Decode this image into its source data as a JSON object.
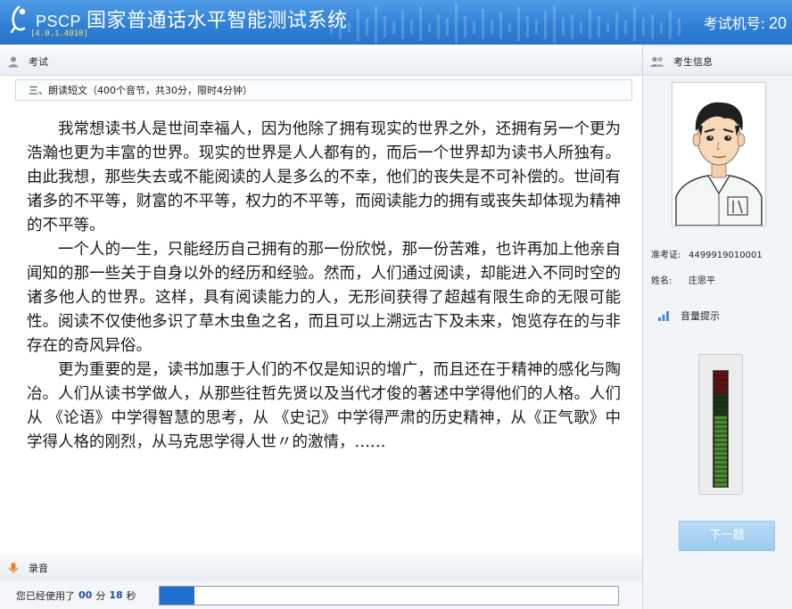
{
  "header": {
    "brand": "PSCP",
    "title": "国家普通话水平智能测试系统",
    "version": "[4.0.1.4010]",
    "machine_label": "考试机号:",
    "machine_number": "20"
  },
  "exam": {
    "section_label": "考试",
    "question_title": "三、朗读短文（400个音节，共30分，限时4分钟）",
    "paragraphs": [
      "我常想读书人是世间幸福人，因为他除了拥有现实的世界之外，还拥有另一个更为浩瀚也更为丰富的世界。现实的世界是人人都有的，而后一个世界却为读书人所独有。由此我想，那些失去或不能阅读的人是多么的不幸，他们的丧失是不可补偿的。世间有诸多的不平等，财富的不平等，权力的不平等，而阅读能力的拥有或丧失却体现为精神的不平等。",
      "一个人的一生，只能经历自己拥有的那一份欣悦，那一份苦难，也许再加上他亲自闻知的那一些关于自身以外的经历和经验。然而，人们通过阅读，却能进入不同时空的诸多他人的世界。这样，具有阅读能力的人，无形间获得了超越有限生命的无限可能性。阅读不仅使他多识了草木虫鱼之名，而且可以上溯远古下及未来，饱览存在的与非存在的奇风异俗。",
      "更为重要的是，读书加惠于人们的不仅是知识的增广，而且还在于精神的感化与陶冶。人们从读书学做人，从那些往哲先贤以及当代才俊的著述中学得他们的人格。人们从 《论语》中学得智慧的思考，从 《史记》中学得严肃的历史精神，从《正气歌》中学得人格的刚烈，从马克思学得人世〃的激情，……"
    ]
  },
  "recording": {
    "section_label": "录音",
    "used_label": "您已经使用了",
    "minutes": "00",
    "minutes_unit": "分",
    "seconds": "18",
    "seconds_unit": "秒",
    "progress_fraction": 0.075
  },
  "candidate": {
    "section_label": "考生信息",
    "id_label": "准考证:",
    "id_value": "4499919010001",
    "name_label": "姓名:",
    "name_value": "庄思平",
    "volume_label": "音量提示",
    "volume_level": 0.6,
    "next_button": "下一题"
  },
  "colors": {
    "header": "#2f7fd6",
    "progress": "#1f6fd0",
    "meter_green": "#3a7d2a",
    "meter_red": "#6b1010"
  }
}
